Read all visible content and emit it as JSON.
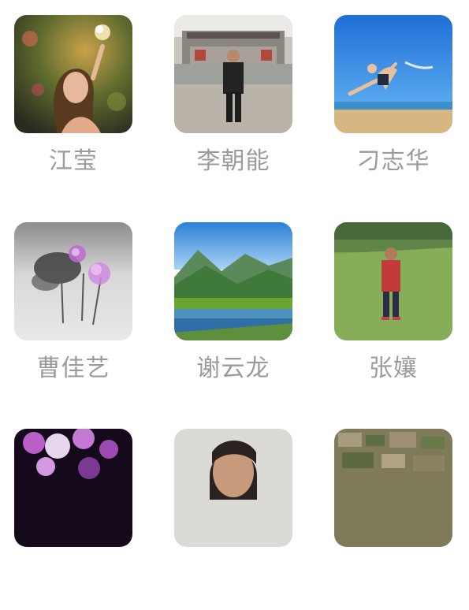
{
  "contacts": [
    {
      "name": "江莹",
      "avatar": "woman-lotus-photo"
    },
    {
      "name": "李朝能",
      "avatar": "man-courtyard-photo"
    },
    {
      "name": "刁志华",
      "avatar": "beach-runner-photo"
    },
    {
      "name": "曹佳艺",
      "avatar": "ink-lotus-painting"
    },
    {
      "name": "谢云龙",
      "avatar": "mountain-lake-photo"
    },
    {
      "name": "张孃",
      "avatar": "woman-meadow-photo"
    },
    {
      "name": "",
      "avatar": "purple-flowers-photo"
    },
    {
      "name": "",
      "avatar": "woman-portrait-photo"
    },
    {
      "name": "",
      "avatar": "village-aerial-photo"
    }
  ],
  "colors": {
    "name_text": "#9b9b9b",
    "background": "#ffffff"
  }
}
